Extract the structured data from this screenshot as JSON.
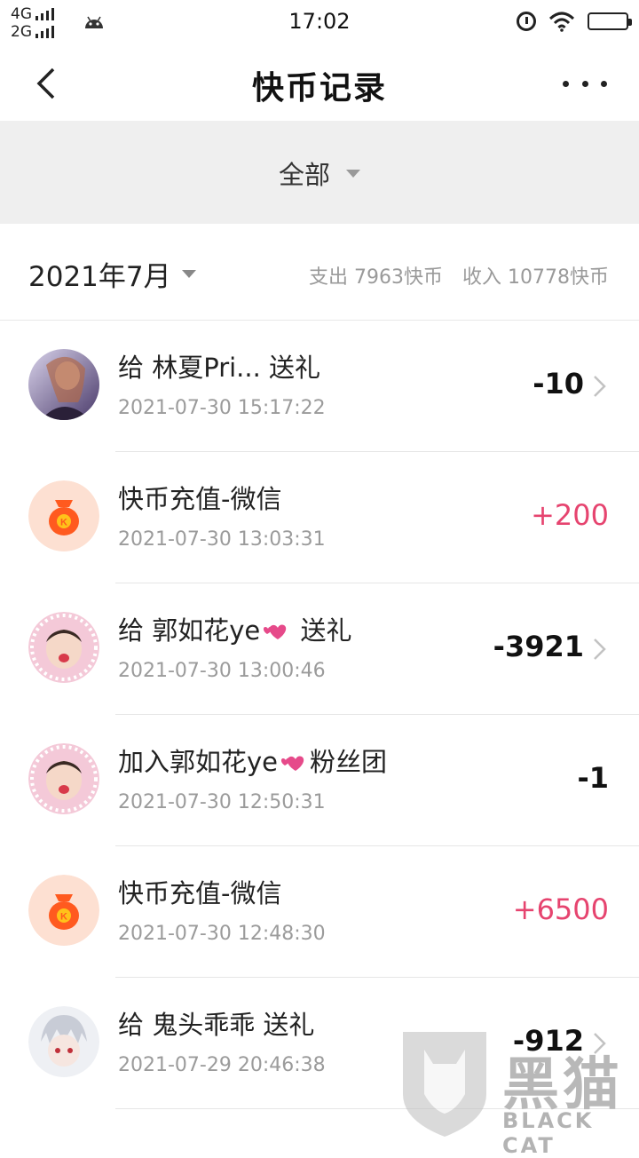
{
  "status_bar": {
    "net_top": "4G",
    "net_bottom": "2G",
    "time": "17:02"
  },
  "nav": {
    "title": "快币记录"
  },
  "filter": {
    "label": "全部"
  },
  "month_header": {
    "month": "2021年7月",
    "expense": "支出 7963快币",
    "income": "收入 10778快币"
  },
  "records": [
    {
      "title": "给 林夏Pri... 送礼",
      "time": "2021-07-30 15:17:22",
      "amount": "-10",
      "avatar": "user-photo",
      "has_arrow": true
    },
    {
      "title": "快币充值-微信",
      "time": "2021-07-30 13:03:31",
      "amount": "+200",
      "avatar": "coin-bag-icon",
      "has_arrow": false
    },
    {
      "title_prefix": "给 郭如花ye",
      "title_suffix": " 送礼",
      "time": "2021-07-30 13:00:46",
      "amount": "-3921",
      "avatar": "user-photo",
      "has_arrow": true
    },
    {
      "title_prefix": "加入郭如花ye",
      "title_suffix": "粉丝团",
      "time": "2021-07-30 12:50:31",
      "amount": "-1",
      "avatar": "user-photo",
      "has_arrow": false
    },
    {
      "title": "快币充值-微信",
      "time": "2021-07-30 12:48:30",
      "amount": "+6500",
      "avatar": "coin-bag-icon",
      "has_arrow": false
    },
    {
      "title": "给 鬼头乖乖 送礼",
      "time": "2021-07-29 20:46:38",
      "amount": "-912",
      "avatar": "user-photo",
      "has_arrow": true
    }
  ],
  "watermark": {
    "cn": "黑猫",
    "en": "BLACK CAT"
  },
  "colors": {
    "income": "#e6446f",
    "expense": "#111111",
    "filter_bg": "#efefef",
    "coin_bag": "#ff5a1f"
  }
}
